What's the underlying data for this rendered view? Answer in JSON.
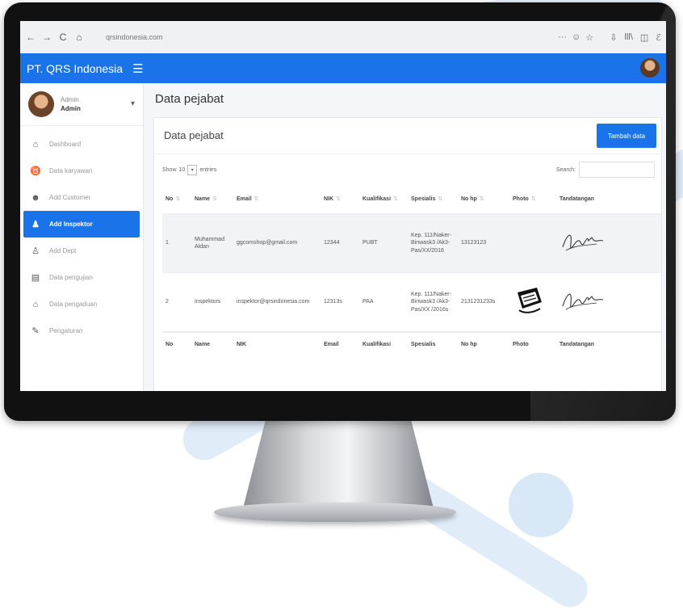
{
  "browser": {
    "back": "←",
    "forward": "→",
    "reload": "C",
    "home": "⌂",
    "url": "qrsindonesia.com",
    "tools": [
      "···",
      "☺",
      "☆"
    ],
    "right_icons": [
      "⇩",
      "lll\\",
      "◫",
      "ℰ"
    ]
  },
  "header": {
    "brand": "PT. QRS Indonesia",
    "menu_glyph": "☰"
  },
  "sidebar": {
    "user_name": "Admin",
    "user_role": "Admin",
    "items": [
      {
        "label": "Dashboard",
        "glyph": "⌂"
      },
      {
        "label": "Data karyawan",
        "glyph": "♉"
      },
      {
        "label": "Add Customer",
        "glyph": "☻"
      },
      {
        "label": "Add Inspektor",
        "glyph": "♟"
      },
      {
        "label": "Add Dept",
        "glyph": "♙"
      },
      {
        "label": "Data pengujian",
        "glyph": "▤"
      },
      {
        "label": "Data pengaduan",
        "glyph": "⌂"
      },
      {
        "label": "Pengaturan",
        "glyph": "✎"
      }
    ],
    "active_index": 3
  },
  "page": {
    "title": "Data pejabat",
    "card_title": "Data pejabat",
    "add_button": "Tambah data",
    "show_label": "Show",
    "show_value": "10",
    "entries_label": "entries",
    "search_label": "Search:"
  },
  "table": {
    "headers": [
      "No",
      "Name",
      "Email",
      "NIK",
      "Kualifikasi",
      "Spesialis",
      "No hp",
      "Photo",
      "Tandatangan"
    ],
    "rows": [
      {
        "no": "1",
        "name": "Muhammad Aldan",
        "email": "ggcomshop@gmail.com",
        "nik": "12344",
        "kualifikasi": "PUBT",
        "spesialis": "Kep. 111/Naker-Binwask3 /Ak3-Pas/XX/2016",
        "hp": "13123123"
      },
      {
        "no": "2",
        "name": "Inspektors",
        "email": "inspektor@qrsindonesia.com",
        "nik": "12313s",
        "kualifikasi": "PAA",
        "spesialis": "Kep. 111/Naker-Binwask3 /Ak3-Pas/XX /2016s",
        "hp": "2131231233s"
      }
    ],
    "footer": [
      "No",
      "Name",
      "NIK",
      "Email",
      "Kualifikasi",
      "Spesialis",
      "No hp",
      "Photo",
      "Tandatangan"
    ]
  }
}
